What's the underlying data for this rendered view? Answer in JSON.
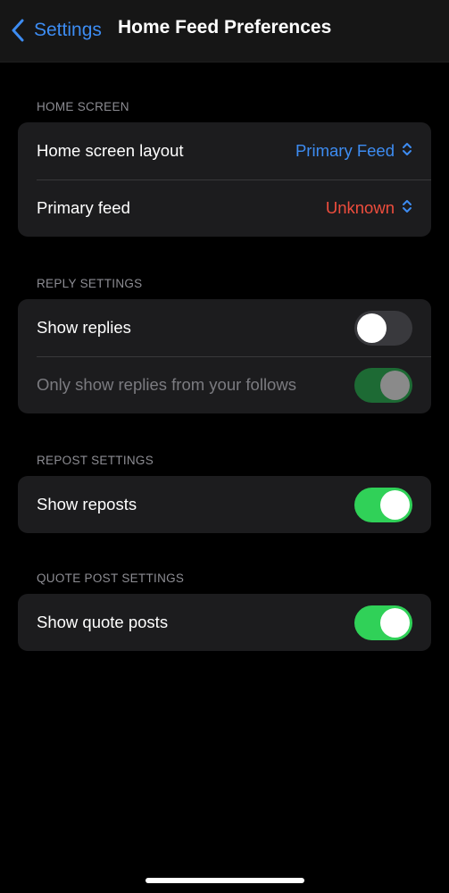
{
  "nav": {
    "back_label": "Settings",
    "title": "Home Feed Preferences"
  },
  "colors": {
    "accent": "#3d8cf2",
    "warning": "#ee4d3d",
    "toggle_on": "#30d158",
    "toggle_off": "#39393d"
  },
  "sections": {
    "home_screen": {
      "header": "HOME SCREEN",
      "layout_label": "Home screen layout",
      "layout_value": "Primary Feed",
      "primary_feed_label": "Primary feed",
      "primary_feed_value": "Unknown"
    },
    "reply_settings": {
      "header": "REPLY SETTINGS",
      "show_replies_label": "Show replies",
      "show_replies_on": false,
      "follows_only_label": "Only show replies from your follows",
      "follows_only_on": true,
      "follows_only_enabled": false
    },
    "repost_settings": {
      "header": "REPOST SETTINGS",
      "show_reposts_label": "Show reposts",
      "show_reposts_on": true
    },
    "quote_post_settings": {
      "header": "QUOTE POST SETTINGS",
      "show_quote_posts_label": "Show quote posts",
      "show_quote_posts_on": true
    }
  },
  "icons": {
    "back": "chevron-left-icon",
    "picker": "chevron-up-down-icon"
  }
}
